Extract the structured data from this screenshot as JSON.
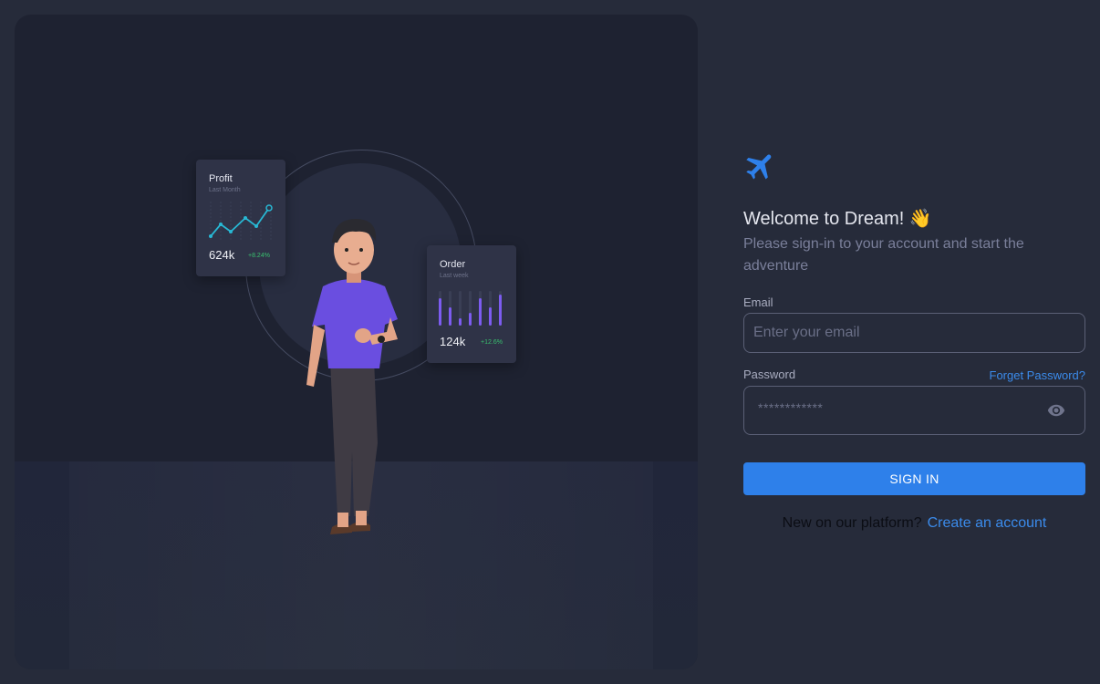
{
  "illustration": {
    "profit_card": {
      "title": "Profit",
      "subtitle": "Last Month",
      "value": "624k",
      "change": "+8.24%"
    },
    "order_card": {
      "title": "Order",
      "subtitle": "Last week",
      "value": "124k",
      "change": "+12.6%"
    }
  },
  "brand": {
    "icon": "airplane-icon",
    "color": "#2e80ea"
  },
  "login": {
    "welcome": "Welcome to Dream! 👋",
    "subtitle": "Please sign-in to your account and start the adventure",
    "email_label": "Email",
    "email_placeholder": "Enter your email",
    "email_value": "",
    "password_label": "Password",
    "forgot_password": "Forget Password?",
    "password_mask": "************",
    "sign_in": "SIGN IN",
    "new_user_text": "New on our platform?",
    "create_account": "Create an account"
  },
  "colors": {
    "accent": "#2e80ea",
    "background": "#262b3a",
    "panel": "#1e2231"
  }
}
